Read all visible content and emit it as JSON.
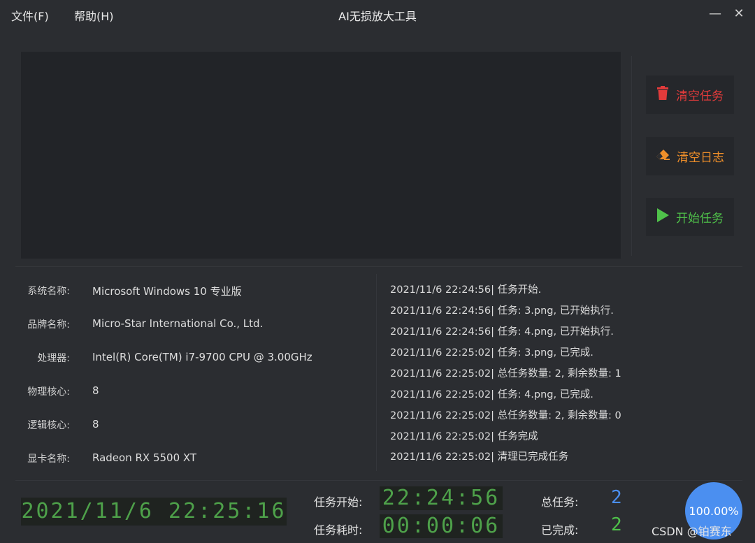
{
  "menu": {
    "file": "文件(F)",
    "help": "帮助(H)"
  },
  "window": {
    "title": "AI无损放大工具",
    "minimize_glyph": "—",
    "close_glyph": "✕"
  },
  "actions": {
    "clear_tasks": {
      "label": "清空任务",
      "icon": "trash-icon",
      "color": "#e23b3b"
    },
    "clear_log": {
      "label": "清空日志",
      "icon": "eraser-icon",
      "color": "#ef8f2a"
    },
    "start_tasks": {
      "label": "开始任务",
      "icon": "play-icon",
      "color": "#4fc24a"
    }
  },
  "system_info": [
    {
      "label": "系统名称:",
      "value": "Microsoft Windows 10 专业版"
    },
    {
      "label": "品牌名称:",
      "value": "Micro-Star International Co., Ltd."
    },
    {
      "label": "处理器:",
      "value": "Intel(R) Core(TM) i7-9700 CPU @ 3.00GHz"
    },
    {
      "label": "物理核心:",
      "value": "8"
    },
    {
      "label": "逻辑核心:",
      "value": "8"
    },
    {
      "label": "显卡名称:",
      "value": "Radeon RX 5500 XT"
    }
  ],
  "log": [
    "2021/11/6 22:24:56| 任务开始.",
    "2021/11/6 22:24:56| 任务: 3.png, 已开始执行.",
    "2021/11/6 22:24:56| 任务: 4.png, 已开始执行.",
    "2021/11/6 22:25:02| 任务: 3.png, 已完成.",
    "2021/11/6 22:25:02| 总任务数量: 2, 剩余数量: 1",
    "2021/11/6 22:25:02| 任务: 4.png, 已完成.",
    "2021/11/6 22:25:02| 总任务数量: 2, 剩余数量: 0",
    "2021/11/6 22:25:02| 任务完成",
    "2021/11/6 22:25:02| 清理已完成任务"
  ],
  "status": {
    "clock": "2021/11/6 22:25:16",
    "task_start_label": "任务开始:",
    "task_start": "22:24:56",
    "elapsed_label": "任务耗时:",
    "elapsed": "00:00:06",
    "total_label": "总任务:",
    "total": "2",
    "done_label": "已完成:",
    "done": "2",
    "progress_text": "100.00%",
    "progress": 1.0
  },
  "colors": {
    "lcd_green": "#4ea14a",
    "total_blue": "#4b8ff0",
    "done_green": "#4fc24a",
    "progress_blue": "#4b8ff0"
  },
  "watermark": "CSDN @铂赛东"
}
